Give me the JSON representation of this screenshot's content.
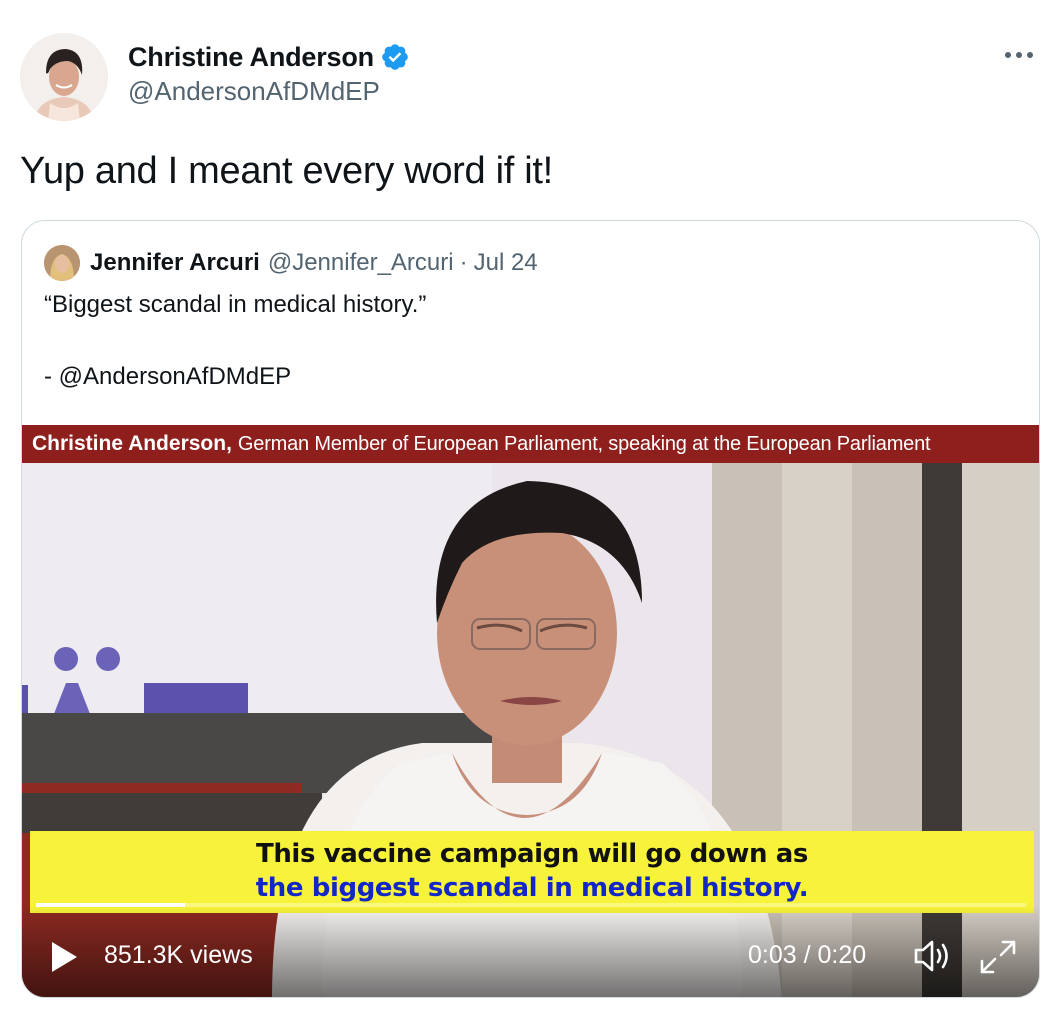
{
  "author": {
    "name": "Christine Anderson",
    "handle": "@AndersonAfDMdEP",
    "verified": true
  },
  "tweet": {
    "text": "Yup and I meant every word if it!"
  },
  "quoted_tweet": {
    "author_name": "Jennifer Arcuri",
    "author_handle": "@Jennifer_Arcuri",
    "separator": "·",
    "date": "Jul 24",
    "text_line1": "“Biggest scandal in medical history.”",
    "text_line2": "- @AndersonAfDMdEP",
    "video": {
      "banner_name": "Christine Anderson,",
      "banner_desc": "German Member of European Parliament, speaking at the European Parliament",
      "subtitle_line1": "This vaccine campaign will go down as",
      "subtitle_line2": "the biggest scandal in medical history.",
      "views": "851.3K views",
      "time": "0:03 / 0:20",
      "progress_fraction": 0.15
    }
  },
  "icons": {
    "more": "more-icon",
    "verified": "verified-badge-icon",
    "play": "play-icon",
    "volume": "volume-icon",
    "fullscreen": "fullscreen-icon"
  },
  "colors": {
    "verified_blue": "#1d9bf0",
    "banner_red": "#8e1f1c",
    "subtitle_yellow": "#f7f33a",
    "subtitle_blue": "#1326c8",
    "secondary_text": "#536471"
  }
}
